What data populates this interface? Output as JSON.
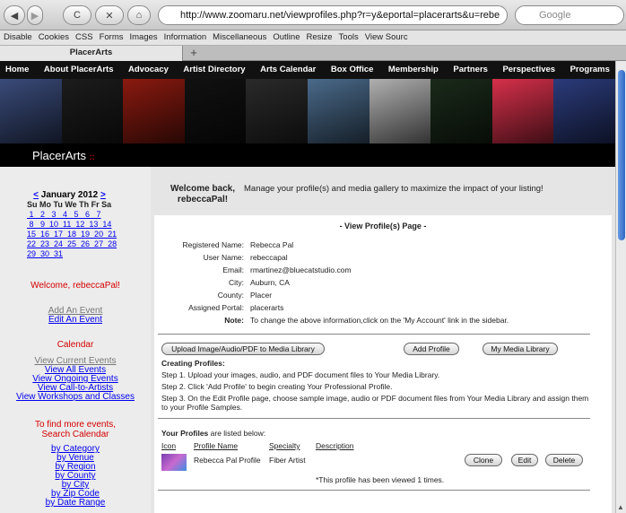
{
  "browser": {
    "back": "◀",
    "forward": "▶",
    "reload": "C",
    "stop": "✕",
    "home": "⌂",
    "url": "http://www.zoomaru.net/viewprofiles.php?r=y&eportal=placerarts&u=rebe",
    "search_placeholder": "Google",
    "tab_title": "PlacerArts",
    "new_tab": "+",
    "devbar": [
      "Disable",
      "Cookies",
      "CSS",
      "Forms",
      "Images",
      "Information",
      "Miscellaneous",
      "Outline",
      "Resize",
      "Tools",
      "View Sourc"
    ]
  },
  "site": {
    "nav": [
      "Home",
      "About PlacerArts",
      "Advocacy",
      "Artist Directory",
      "Arts Calendar",
      "Box Office",
      "Membership",
      "Partners",
      "Perspectives",
      "Programs"
    ],
    "brand": "PlacerArts",
    "brand_mark": "::",
    "banner_colors": [
      "#3a4b7a",
      "#1c1c1c",
      "#8a1a10",
      "#111",
      "#2a2a2a",
      "#4a6a8a",
      "#b0b0b0",
      "#1a2a1a",
      "#d6304a",
      "#2b3b7b"
    ]
  },
  "sidebar": {
    "cal_month": "January 2012",
    "cal_prev": "<",
    "cal_next": ">",
    "cal_days": "Su Mo Tu We Th Fr Sa",
    "cal_rows": [
      " 1   2   3   4   5   6   7",
      " 8   9  10  11  12  13  14",
      "15  16  17  18  19  20  21",
      "22  23  24  25  26  27  28",
      "29  30  31"
    ],
    "welcome": "Welcome, rebeccaPal!",
    "add_event": "Add An Event",
    "edit_event": "Edit An Event",
    "calendar_heading": "Calendar",
    "calendar_links": [
      "View Current Events",
      "View All Events",
      "View Ongoing Events",
      "View Call-to-Artists",
      "View Workshops and Classes"
    ],
    "find_more": "To find more events, Search Calendar",
    "search_links": [
      "by Category",
      "by Venue",
      "by Region",
      "by County",
      "by City",
      "by Zip Code",
      "by Date Range"
    ]
  },
  "main": {
    "welcome": "Welcome back, rebeccaPal!",
    "intro": "Manage your profile(s) and media gallery to maximize the impact of your listing!",
    "heading": "- View Profile(s) Page -",
    "fields": [
      {
        "label": "Registered Name:",
        "value": "Rebecca Pal"
      },
      {
        "label": "User Name:",
        "value": "rebeccapal"
      },
      {
        "label": "Email:",
        "value": "rmartinez@bluecatstudio.com"
      },
      {
        "label": "City:",
        "value": "Auburn, CA"
      },
      {
        "label": "County:",
        "value": "Placer"
      },
      {
        "label": "Assigned Portal:",
        "value": "placerarts"
      }
    ],
    "note_label": "Note:",
    "note": "To change the above information,click on the 'My Account' link in the sidebar.",
    "upload_btn": "Upload Image/Audio/PDF to Media Library",
    "add_profile_btn": "Add Profile",
    "media_btn": "My Media Library",
    "creating_heading": "Creating Profiles:",
    "steps": [
      "Step 1. Upload your images, audio, and PDF document files to Your Media Library.",
      "Step 2. Click 'Add Profile' to begin creating Your Professional Profile.",
      "Step 3. On the Edit Profile page, choose sample image, audio or PDF document files from Your Media Library and assign them to your Profile Samples."
    ],
    "your_profiles_bold": "Your Profiles",
    "your_profiles_rest": " are listed below:",
    "columns": [
      "Icon",
      "Profile Name",
      "Specialty",
      "Description"
    ],
    "profile": {
      "name": "Rebecca Pal Profile",
      "specialty": "Fiber Artist",
      "description": ""
    },
    "clone_btn": "Clone",
    "edit_btn": "Edit",
    "delete_btn": "Delete",
    "views": "*This profile has been viewed 1 times."
  }
}
